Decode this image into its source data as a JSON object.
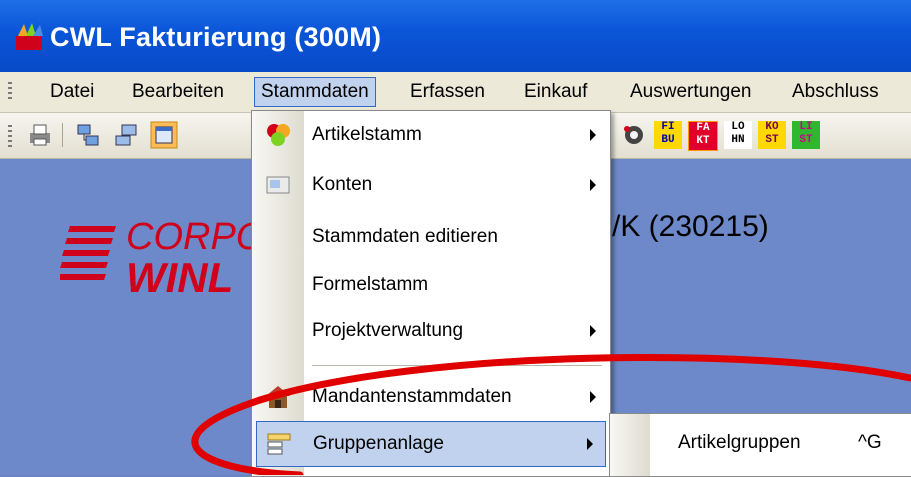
{
  "window": {
    "title": "CWL Fakturierung (300M)"
  },
  "menubar": {
    "items": [
      {
        "label": "Datei"
      },
      {
        "label": "Bearbeiten"
      },
      {
        "label": "Stammdaten"
      },
      {
        "label": "Erfassen"
      },
      {
        "label": "Einkauf"
      },
      {
        "label": "Auswertungen"
      },
      {
        "label": "Abschluss"
      }
    ]
  },
  "toolbar": {
    "module_buttons": [
      {
        "top": "FI",
        "bottom": "BU"
      },
      {
        "top": "FA",
        "bottom": "KT"
      },
      {
        "top": "LO",
        "bottom": "HN"
      },
      {
        "top": "KO",
        "bottom": "ST"
      },
      {
        "top": "LI",
        "bottom": "ST"
      }
    ]
  },
  "background": {
    "logo_line1": "CORPO",
    "logo_line2": "WINL",
    "mandant_text": "/K (230215)"
  },
  "dropdown": {
    "items": [
      {
        "label": "Artikelstamm"
      },
      {
        "label": "Konten"
      },
      {
        "label": "Stammdaten editieren"
      },
      {
        "label": "Formelstamm"
      },
      {
        "label": "Projektverwaltung"
      },
      {
        "label": "Mandantenstammdaten"
      },
      {
        "label": "Gruppenanlage"
      }
    ]
  },
  "submenu": {
    "label": "Artikelgruppen",
    "shortcut": "^G"
  },
  "colors": {
    "titlebar": "#0a55d8",
    "highlight": "#c1d2ee",
    "annotation": "#e00000"
  }
}
